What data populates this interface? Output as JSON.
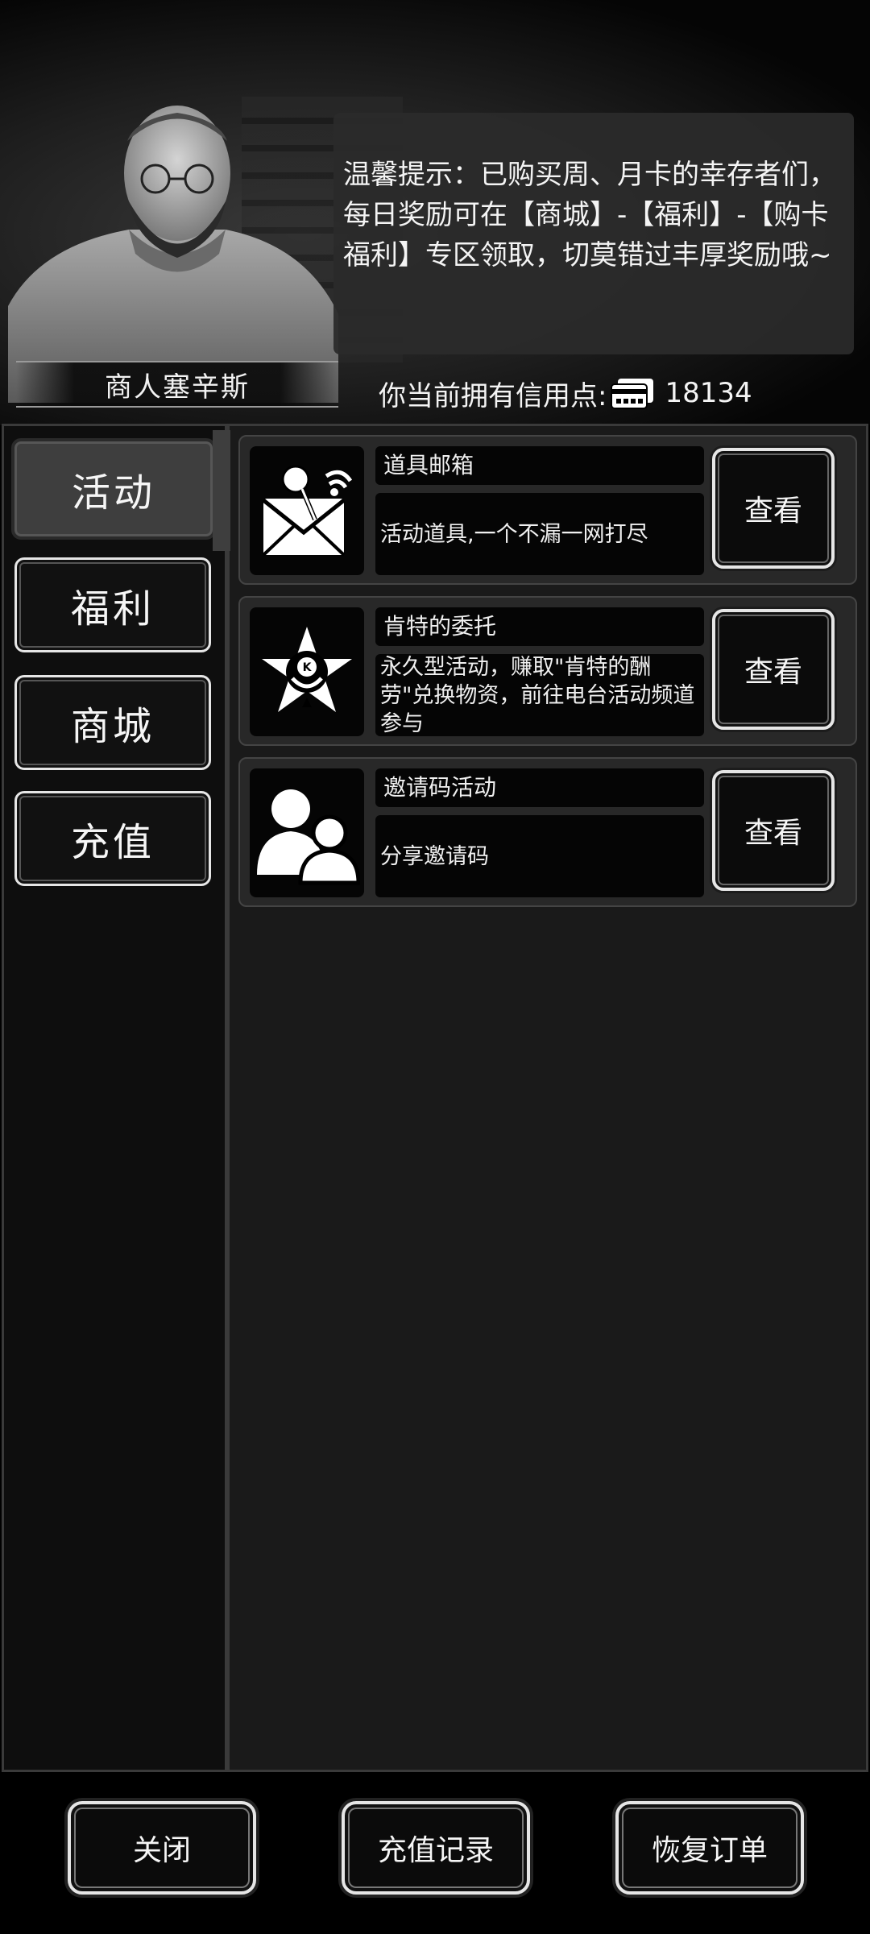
{
  "header": {
    "merchant_name": "商人塞辛斯",
    "tip": "温馨提示：已购买周、月卡的幸存者们，每日奖励可在【商城】-【福利】-【购卡福利】专区领取，切莫错过丰厚奖励哦~",
    "credits_label": "你当前拥有信用点:",
    "credits_value": "18134"
  },
  "sidebar": {
    "tabs": [
      {
        "label": "活动",
        "active": true
      },
      {
        "label": "福利",
        "active": false
      },
      {
        "label": "商城",
        "active": false
      },
      {
        "label": "充值",
        "active": false
      }
    ]
  },
  "activities": [
    {
      "title": "道具邮箱",
      "desc": "活动道具,一个不漏一网打尽",
      "button": "查看",
      "icon": "mail-pin-icon"
    },
    {
      "title": "肯特的委托",
      "desc": "永久型活动，赚取\"肯特的酬劳\"兑换物资，前往电台活动频道参与",
      "button": "查看",
      "icon": "kent-badge-icon"
    },
    {
      "title": "邀请码活动",
      "desc": "分享邀请码",
      "button": "查看",
      "icon": "users-icon"
    }
  ],
  "bottom": {
    "close": "关闭",
    "recharge_history": "充值记录",
    "restore_orders": "恢复订单"
  }
}
